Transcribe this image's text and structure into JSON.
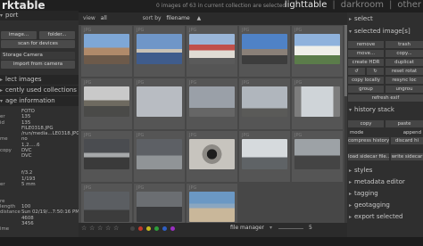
{
  "app": {
    "title": "rktable"
  },
  "header": {
    "status": "0 images of 63 in current collection are selected"
  },
  "views": [
    {
      "label": "lighttable",
      "active": true
    },
    {
      "label": "|",
      "sep": true
    },
    {
      "label": "darkroom",
      "active": false
    },
    {
      "label": "|",
      "sep": true
    },
    {
      "label": "other",
      "active": false
    }
  ],
  "left": {
    "import_head": "port",
    "image_btn": "image...",
    "folder_btn": "folder...",
    "scan_btn": "scan for devices",
    "storage_btn": "Storage Camera",
    "import_camera_btn": "import from camera",
    "collect_head": "lect images",
    "recent_head": "cently used collections",
    "info_head": "age information",
    "meta_labels": [
      "",
      "er",
      "id",
      "",
      "",
      "me",
      "",
      "copy",
      "",
      "",
      "",
      "",
      "",
      "er",
      "",
      "",
      "re",
      "length",
      "distance",
      "",
      "",
      "ime",
      "",
      "",
      "d width",
      "d height"
    ],
    "meta_values": [
      "FOTO",
      "135",
      "135",
      "FILE0318.JPG",
      "/run/media...LE0318.JPG",
      "no",
      "1,2.....6",
      "DVC",
      "DVC",
      "",
      "",
      "f/3.2",
      "1/193",
      "5 mm",
      "",
      "",
      "",
      "100",
      "Sun 02/19/...7:50:16 PM",
      "4608",
      "3456",
      "",
      "",
      "",
      "",
      ""
    ]
  },
  "toolbar": {
    "view": "view",
    "view_value": "all",
    "sort": "sort by",
    "sort_value": "filename",
    "sort_arrow": "▲"
  },
  "grid": {
    "tag": "JPG",
    "cells": [
      {
        "photo": "a"
      },
      {
        "photo": "b"
      },
      {
        "photo": "c"
      },
      {
        "photo": "d"
      },
      {
        "photo": "e"
      },
      {
        "photo": "f"
      },
      {
        "photo": "g"
      },
      {
        "photo": "h"
      },
      {
        "photo": "i"
      },
      {
        "photo": "j"
      },
      {
        "photo": "k"
      },
      {
        "photo": "l"
      },
      {
        "photo": "m"
      },
      {
        "photo": "n"
      },
      {
        "photo": "o"
      },
      {
        "photo": "p"
      },
      {
        "photo": "q"
      },
      {
        "photo": "r"
      }
    ]
  },
  "bottom": {
    "stars": [
      "☆",
      "☆",
      "☆",
      "☆",
      "☆"
    ],
    "labels": [
      {
        "color": "#444444",
        "name": "none"
      },
      {
        "color": "#c0392b",
        "name": "red"
      },
      {
        "color": "#c7b81f",
        "name": "yellow"
      },
      {
        "color": "#2e9e3a",
        "name": "green"
      },
      {
        "color": "#2f5fc4",
        "name": "blue"
      },
      {
        "color": "#9b2fc2",
        "name": "purple"
      }
    ],
    "mode": "file manager",
    "zoom": "5"
  },
  "right": {
    "select_head": "select",
    "selected_head": "selected image[s]",
    "btns": {
      "remove": "remove",
      "trash": "trash",
      "move": "move...",
      "copy": "copy...",
      "create_hdr": "create HDR",
      "duplicate": "duplicat",
      "rotate_ccw": "↺",
      "rotate_cw": "↻",
      "reset_rotation": "reset rotat",
      "copy_locally": "copy locally",
      "resync_local": "resync loc",
      "group": "group",
      "ungroup": "ungrou",
      "refresh_exif": "refresh exif"
    },
    "history_head": "history stack",
    "h_copy": "copy",
    "h_paste": "paste",
    "h_mode": "mode",
    "h_mode_value": "append",
    "h_compress": "compress history",
    "h_discard": "discard hi",
    "h_load": "load sidecar file...",
    "h_write": "write sidecar",
    "styles": "styles",
    "metadata": "metadata editor",
    "tagging": "tagging",
    "geotagging": "geotagging",
    "export": "export selected"
  }
}
